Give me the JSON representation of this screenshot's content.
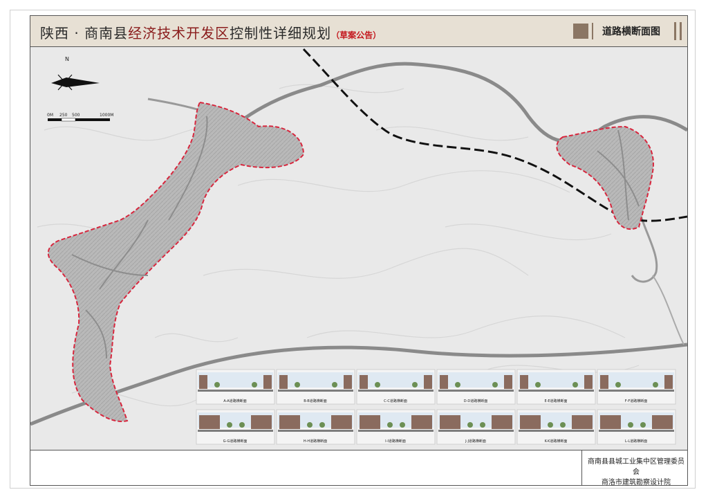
{
  "header": {
    "title_prefix": "陕西 · 商南县",
    "title_highlight": "经济技术开发区",
    "title_suffix": "控制性详细规划",
    "title_note": "（草案公告）",
    "sheet_name": "道路横断面图"
  },
  "map": {
    "north_label": "N",
    "scale_ticks": [
      "0M",
      "250",
      "500",
      "1000M"
    ],
    "section_labels": [
      "A-A道路横断面",
      "B-B道路横断面",
      "C-C道路横断面",
      "D-D道路横断面",
      "E-E道路横断面",
      "F-F道路横断面",
      "G-G道路横断面",
      "H-H道路横断面",
      "I-I道路横断面",
      "J-J道路横断面",
      "K-K道路横断面",
      "L-L道路横断面"
    ]
  },
  "footer": {
    "client": "商南县县城工业集中区管理委员会",
    "designer": "商洛市建筑勘察设计院"
  },
  "colors": {
    "header_bg": "#e7e0d4",
    "accent_red": "#c4161c",
    "title_red": "#8a1c1c",
    "brown": "#8b7664",
    "boundary": "#d7263d"
  }
}
